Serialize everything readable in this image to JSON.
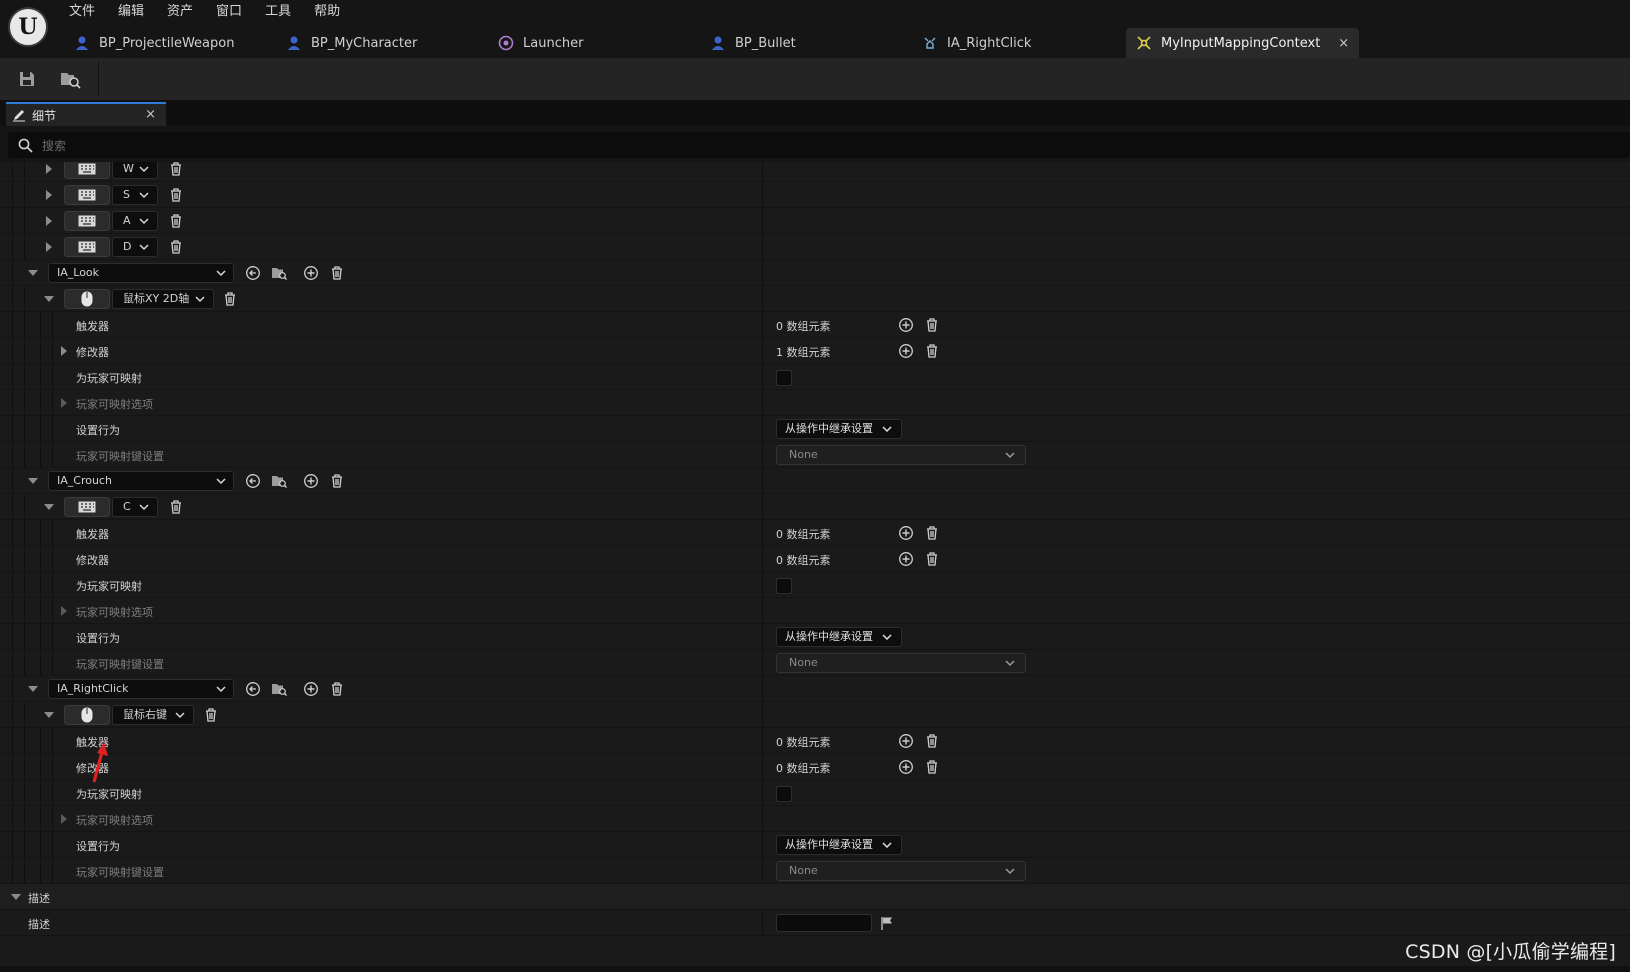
{
  "menu": [
    "文件",
    "编辑",
    "资产",
    "窗口",
    "工具",
    "帮助"
  ],
  "tabs": [
    {
      "label": "BP_ProjectileWeapon",
      "icon": "blueprint-person-icon"
    },
    {
      "label": "BP_MyCharacter",
      "icon": "blueprint-person-icon"
    },
    {
      "label": "Launcher",
      "icon": "launcher-icon"
    },
    {
      "label": "BP_Bullet",
      "icon": "blueprint-person-icon"
    },
    {
      "label": "IA_RightClick",
      "icon": "input-action-icon"
    },
    {
      "label": "MyInputMappingContext",
      "icon": "input-mapping-icon",
      "active": true,
      "close": "×"
    }
  ],
  "toolbar": {
    "save_icon": "save-icon",
    "browse_icon": "browse-asset-icon"
  },
  "panel": {
    "title": "细节",
    "close": "×"
  },
  "search": {
    "placeholder": "搜索"
  },
  "labels": {
    "trigger": "触发器",
    "modifier": "修改器",
    "player_mappable": "为玩家可映射",
    "player_mappable_options": "玩家可映射选项",
    "setting_behavior": "设置行为",
    "player_mappable_key_settings": "玩家可映射键设置",
    "description_section": "描述",
    "description": "描述"
  },
  "keys_top": [
    "W",
    "S",
    "A",
    "D"
  ],
  "mappings": [
    {
      "action": "IA_Look",
      "key": "鼠标XY 2D轴",
      "key_type": "mouse",
      "trigger_count": "0 数组元素",
      "modifier_count": "1 数组元素",
      "modifier_expandable": true,
      "behavior": "从操作中继承设置",
      "key_settings": "None"
    },
    {
      "action": "IA_Crouch",
      "key": "C",
      "key_type": "keyboard",
      "trigger_count": "0 数组元素",
      "modifier_count": "0 数组元素",
      "modifier_expandable": false,
      "behavior": "从操作中继承设置",
      "key_settings": "None"
    },
    {
      "action": "IA_RightClick",
      "key": "鼠标右键",
      "key_type": "mouse",
      "trigger_count": "0 数组元素",
      "modifier_count": "0 数组元素",
      "modifier_expandable": false,
      "behavior": "从操作中继承设置",
      "key_settings": "None"
    }
  ],
  "watermark": "CSDN @[小瓜偷学编程]",
  "colors": {
    "accent": "#2f7ad8",
    "annotation_arrow": "#e02020",
    "tab_active": "#2a2a2a"
  }
}
